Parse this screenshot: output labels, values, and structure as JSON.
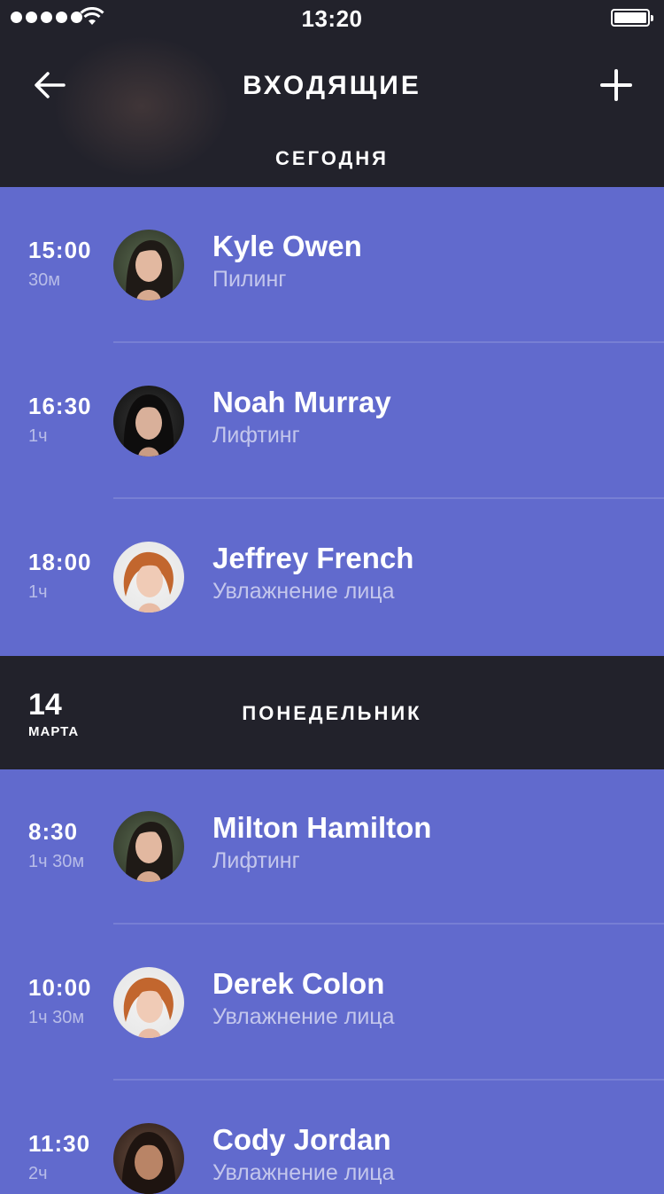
{
  "status_bar": {
    "time": "13:20"
  },
  "nav": {
    "title": "ВХОДЯЩИЕ"
  },
  "sections": {
    "today_label": "СЕГОДНЯ",
    "monday": {
      "day": "14",
      "month": "МАРТА",
      "weekday": "ПОНЕДЕЛЬНИК"
    }
  },
  "today": [
    {
      "time": "15:00",
      "duration": "30м",
      "name": "Kyle Owen",
      "service": "Пилинг",
      "avatar": "dark-haired-woman-avatar"
    },
    {
      "time": "16:30",
      "duration": "1ч",
      "name": "Noah Murray",
      "service": "Лифтинг",
      "avatar": "black-haired-woman-avatar"
    },
    {
      "time": "18:00",
      "duration": "1ч",
      "name": "Jeffrey French",
      "service": "Увлажнение лица",
      "avatar": "red-haired-woman-avatar"
    }
  ],
  "monday_list": [
    {
      "time": "8:30",
      "duration": "1ч 30м",
      "name": "Milton Hamilton",
      "service": "Лифтинг",
      "avatar": "dark-haired-woman-avatar"
    },
    {
      "time": "10:00",
      "duration": "1ч 30м",
      "name": "Derek Colon",
      "service": "Увлажнение лица",
      "avatar": "red-haired-woman-avatar"
    },
    {
      "time": "11:30",
      "duration": "2ч",
      "name": "Cody Jordan",
      "service": "Увлажнение лица",
      "avatar": "brunette-woman-avatar"
    }
  ],
  "colors": {
    "header_bg": "#22222B",
    "list_bg": "#616ACD"
  }
}
